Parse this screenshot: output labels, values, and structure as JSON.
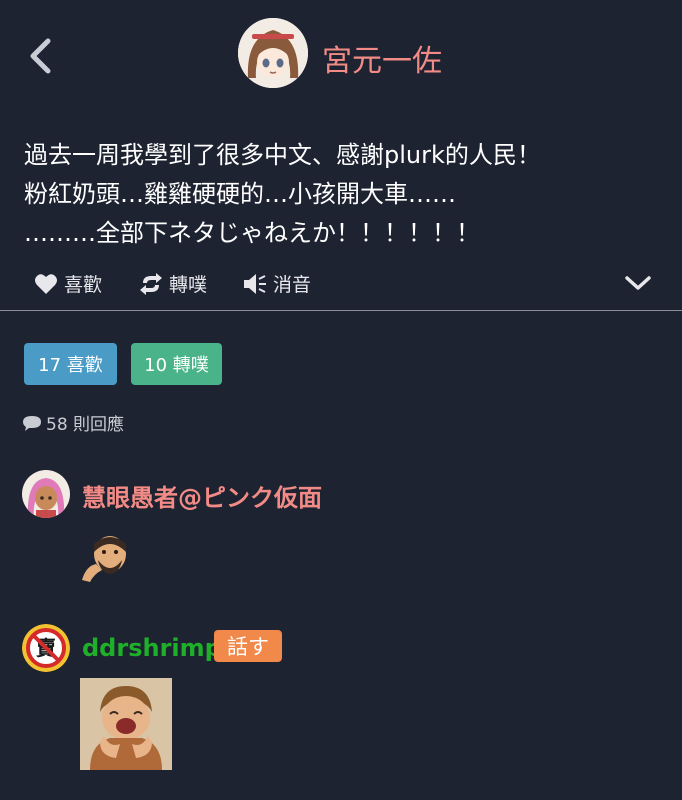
{
  "header": {
    "author_name": "宮元一佐"
  },
  "post": {
    "lines": [
      "過去一周我學到了很多中文、感謝plurk的人民！",
      "粉紅奶頭…雞雞硬硬的…小孩開大車……",
      "………全部下ネタじゃねえか！！！！！！"
    ]
  },
  "actions": {
    "like_label": "喜歡",
    "replurk_label": "轉噗",
    "mute_label": "消音"
  },
  "stats": {
    "likes_badge": "17 喜歡",
    "replurks_badge": "10 轉噗",
    "responses_label": "58 則回應"
  },
  "replies": [
    {
      "name": "慧眼愚者@ピンク仮面",
      "name_color": "#f28b86"
    },
    {
      "name": "ddrshrimp",
      "name_color": "#1fb02a",
      "tag": "話す"
    }
  ],
  "colors": {
    "background": "#1e2332",
    "author": "#f28b86",
    "likes_badge": "#4a9cc7",
    "replurks_badge": "#4ab38a",
    "tag": "#f0894a"
  }
}
